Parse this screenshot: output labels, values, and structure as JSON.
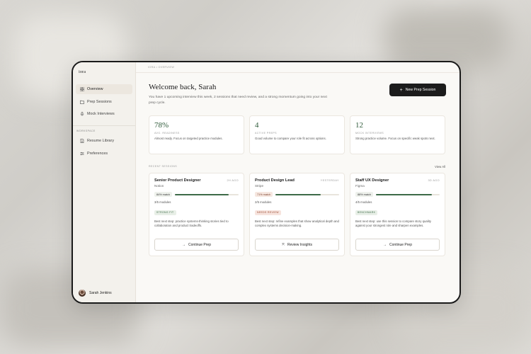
{
  "sidebar": {
    "brand": "iora",
    "nav": [
      {
        "label": "Overview",
        "icon": "grid-icon",
        "active": true
      },
      {
        "label": "Prep Sessions",
        "icon": "folder-icon",
        "active": false
      },
      {
        "label": "Mock Interviews",
        "icon": "microphone-icon",
        "active": false
      }
    ],
    "workspace_label": "WORKSPACE",
    "workspace_nav": [
      {
        "label": "Resume Library",
        "icon": "document-icon"
      },
      {
        "label": "Preferences",
        "icon": "sliders-icon"
      }
    ],
    "user_name": "Sarah Jenkins"
  },
  "breadcrumb": "IORA  •  OVERVIEW",
  "header": {
    "title": "Welcome back, Sarah",
    "subtitle": "You have 1 upcoming interview this week, 2 sessions that need review, and a strong momentum going into your next prep cycle.",
    "new_button": "New Prep Session"
  },
  "stats": [
    {
      "value": "78%",
      "label": "AVG. READINESS",
      "desc": "Almost ready. Focus on targeted practice modules."
    },
    {
      "value": "4",
      "label": "ACTIVE PREPS",
      "desc": "Good volume to compare your role fit across options."
    },
    {
      "value": "12",
      "label": "MOCK INTERVIEWS",
      "desc": "Strong practice volume. Focus on specific weak spots next."
    }
  ],
  "recent": {
    "label": "RECENT SESSIONS",
    "view_all": "View All"
  },
  "sessions": [
    {
      "role": "Senior Product Designer",
      "company": "Notion",
      "when": "2H AGO",
      "match": "84% match",
      "match_pct": 84,
      "modules": "3/5 modules",
      "tag": "STRONG FIT",
      "tag_style": "green",
      "pill_style": "green",
      "note": "Best next step: practice systems-thinking stories tied to collaboration and product tradeoffs.",
      "button": "Continue Prep",
      "button_icon": "arrow-right-icon"
    },
    {
      "role": "Product Design Lead",
      "company": "Stripe",
      "when": "YESTERDAY",
      "match": "71% match",
      "match_pct": 71,
      "modules": "2/5 modules",
      "tag": "NEEDS REVIEW",
      "tag_style": "red",
      "pill_style": "orange",
      "note": "Best next step: refine examples that show analytical depth and complex systems decision-making.",
      "button": "Review Insights",
      "button_icon": "expand-icon"
    },
    {
      "role": "Staff UX Designer",
      "company": "Figma",
      "when": "3D AGO",
      "match": "88% match",
      "match_pct": 88,
      "modules": "4/5 modules",
      "tag": "BENCHMARK",
      "tag_style": "green",
      "pill_style": "green",
      "note": "Best next step: use this session to compare story quality against your strongest role and sharpen examples.",
      "button": "Continue Prep",
      "button_icon": "arrow-right-icon"
    }
  ]
}
